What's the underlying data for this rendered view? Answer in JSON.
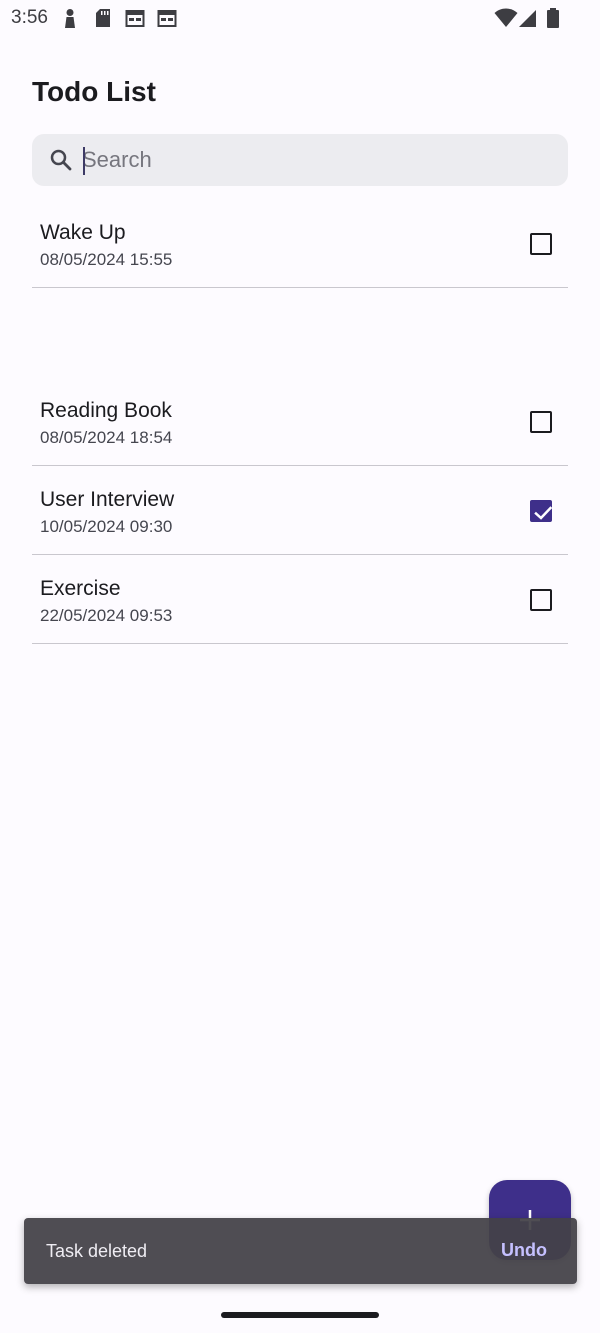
{
  "status_bar": {
    "time": "3:56",
    "icons_left": [
      "notification-person-icon",
      "sd-card-icon",
      "calendar-icon",
      "calendar-icon"
    ],
    "icons_right": [
      "wifi-icon",
      "cell-signal-icon",
      "battery-icon"
    ]
  },
  "header": {
    "title": "Todo List"
  },
  "search": {
    "placeholder": "Search",
    "value": ""
  },
  "todos": [
    {
      "title": "Wake Up",
      "date": "08/05/2024 15:55",
      "checked": false
    },
    {
      "title": "Reading Book",
      "date": "08/05/2024 18:54",
      "checked": false
    },
    {
      "title": "User Interview",
      "date": "10/05/2024 09:30",
      "checked": true
    },
    {
      "title": "Exercise",
      "date": "22/05/2024 09:53",
      "checked": false
    }
  ],
  "fab": {
    "icon": "plus-icon"
  },
  "snackbar": {
    "message": "Task deleted",
    "action_label": "Undo"
  },
  "colors": {
    "accent": "#3e2f8a",
    "background": "#fdfbff",
    "search_bg": "#ececf0",
    "snackbar_bg": "#444248",
    "snackbar_action": "#c5c0ff"
  }
}
